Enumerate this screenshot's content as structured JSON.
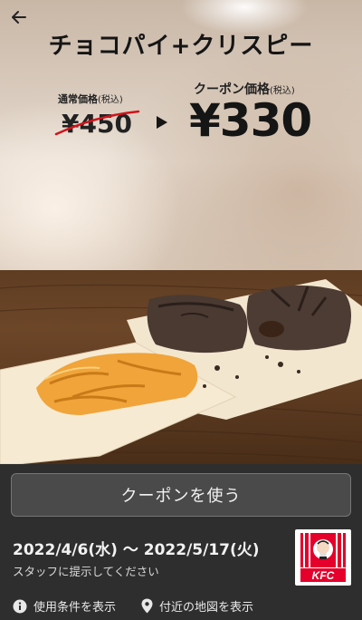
{
  "header": {
    "title": "チョコパイ+クリスピー"
  },
  "pricing": {
    "normal_label": "通常価格",
    "normal_tax": "(税込)",
    "normal_price": "¥450",
    "coupon_label": "クーポン価格",
    "coupon_tax": "(税込)",
    "coupon_price": "¥330"
  },
  "actions": {
    "use_coupon_label": "クーポンを使う",
    "terms_label": "使用条件を表示",
    "map_label": "付近の地図を表示"
  },
  "validity": {
    "date_range": "2022/4/6(水) 〜 2022/5/17(火)",
    "notice": "スタッフに提示してください"
  },
  "brand": {
    "logo_text": "KFC",
    "accent_color": "#e4002b"
  },
  "icons": {
    "back": "back-arrow-icon",
    "arrow": "triangle-right-icon",
    "info": "info-icon",
    "map": "map-pin-icon"
  }
}
